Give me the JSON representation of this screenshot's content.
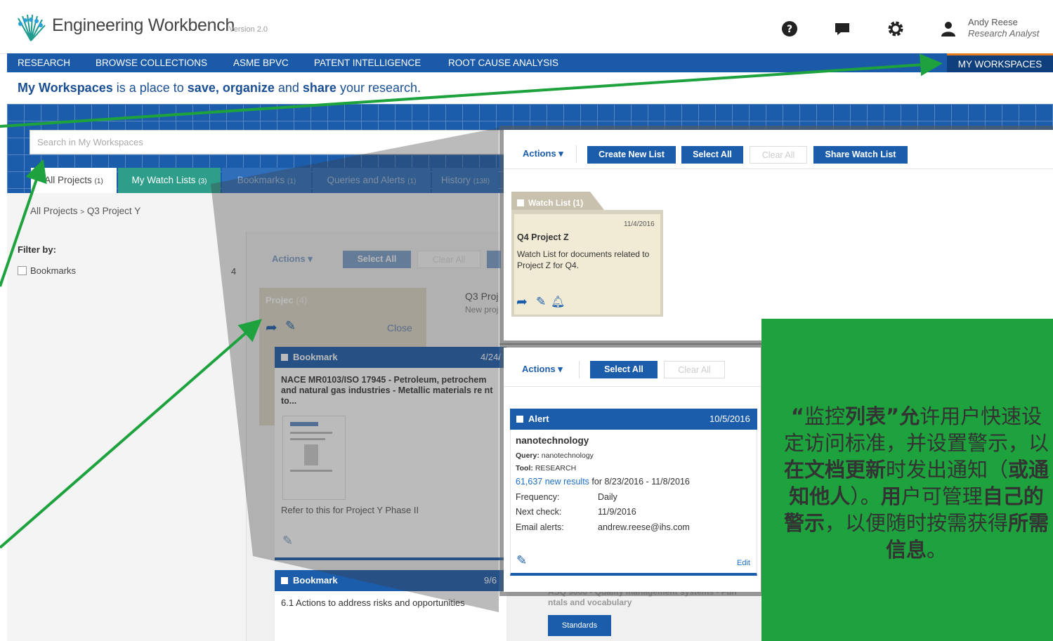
{
  "header": {
    "app_title": "Engineering Workbench",
    "version": "Version 2.0",
    "icons": [
      "help-icon",
      "chat-icon",
      "gear-icon",
      "user-icon"
    ],
    "user_name": "Andy Reese",
    "user_role": "Research Analyst"
  },
  "nav": {
    "items": [
      "RESEARCH",
      "BROWSE COLLECTIONS",
      "ASME BPVC",
      "PATENT INTELLIGENCE",
      "ROOT CAUSE ANALYSIS"
    ],
    "active": "MY WORKSPACES"
  },
  "tagline": {
    "part1": "My Workspaces",
    "part2": " is a place to ",
    "part3": "save, organize",
    "part4": " and ",
    "part5": "share",
    "part6": " your research."
  },
  "search": {
    "placeholder": "Search in My Workspaces"
  },
  "tabs": [
    {
      "label": "All Projects",
      "count": "(1)"
    },
    {
      "label": "My Watch Lists",
      "count": "(3)"
    },
    {
      "label": "Bookmarks",
      "count": "(1)"
    },
    {
      "label": "Queries and Alerts",
      "count": "(1)"
    },
    {
      "label": "History",
      "count": "(138)"
    }
  ],
  "breadcrumb": {
    "root": "All Projects",
    "sep": ">",
    "current": "Q3 Project Y"
  },
  "filter": {
    "label": "Filter by:",
    "item": "Bookmarks",
    "count": "4"
  },
  "main": {
    "actions": "Actions",
    "select_all": "Select All",
    "clear_all": "Clear All",
    "project_tab": "Projec",
    "project_count": "(4)",
    "q3_title": "Q3 Proj",
    "q3_sub": "New proj",
    "close": "Close",
    "bookmark1": {
      "label": "Bookmark",
      "date": "4/24/",
      "title": "NACE MR0103/ISO 17945 - Petroleum, petrochem and natural gas industries - Metallic materials re nt to...",
      "note": "Refer to this for Project Y Phase II"
    },
    "bookmark2": {
      "label": "Bookmark",
      "date": "9/6",
      "title": "6.1 Actions to address risks and opportunities"
    },
    "hidden_title": "ASQ 9000 - Quality management systems - Fun ntals and vocabulary",
    "standards": "Standards"
  },
  "watch_popup": {
    "actions": "Actions",
    "create_new": "Create New List",
    "select_all": "Select All",
    "clear_all": "Clear All",
    "share": "Share Watch List",
    "tab_label": "Watch List (1)",
    "date": "11/4/2016",
    "title": "Q4 Project Z",
    "desc": "Watch List for documents related to Project Z for Q4."
  },
  "alert_popup": {
    "actions": "Actions",
    "select_all": "Select All",
    "clear_all": "Clear All",
    "head": "Alert",
    "date": "10/5/2016",
    "title": "nanotechnology",
    "query_label": "Query:",
    "query_value": "nanotechnology",
    "tool_label": "Tool:",
    "tool_value": "RESEARCH",
    "results_link": "61,637 new results",
    "results_range": " for 8/23/2016 - 11/8/2016",
    "freq_label": "Frequency:",
    "freq_value": "Daily",
    "next_label": "Next check:",
    "next_value": "11/9/2016",
    "email_label": "Email alerts:",
    "email_value": "andrew.reese@ihs.com",
    "edit": "Edit"
  },
  "callout": {
    "q1": "“",
    "t1": "监控",
    "t2": "列表",
    "q2": "”",
    "t3": "允",
    "t4": "许用户快速设定访问标准，并设置警示，以",
    "t5": "在文档更新",
    "t6": "时发出通知（",
    "t7": "或通知他人",
    "t8": "）。",
    "t9": "用",
    "t10": "户可管理",
    "t11": "自己的警示",
    "t12": "，以便随时按需获得",
    "t13": "所需信息",
    "t14": "。"
  },
  "colors": {
    "nav": "#1b5aa8",
    "accent": "#1c5dab",
    "callout": "#1ea23e",
    "arrow": "#1ea23e"
  }
}
